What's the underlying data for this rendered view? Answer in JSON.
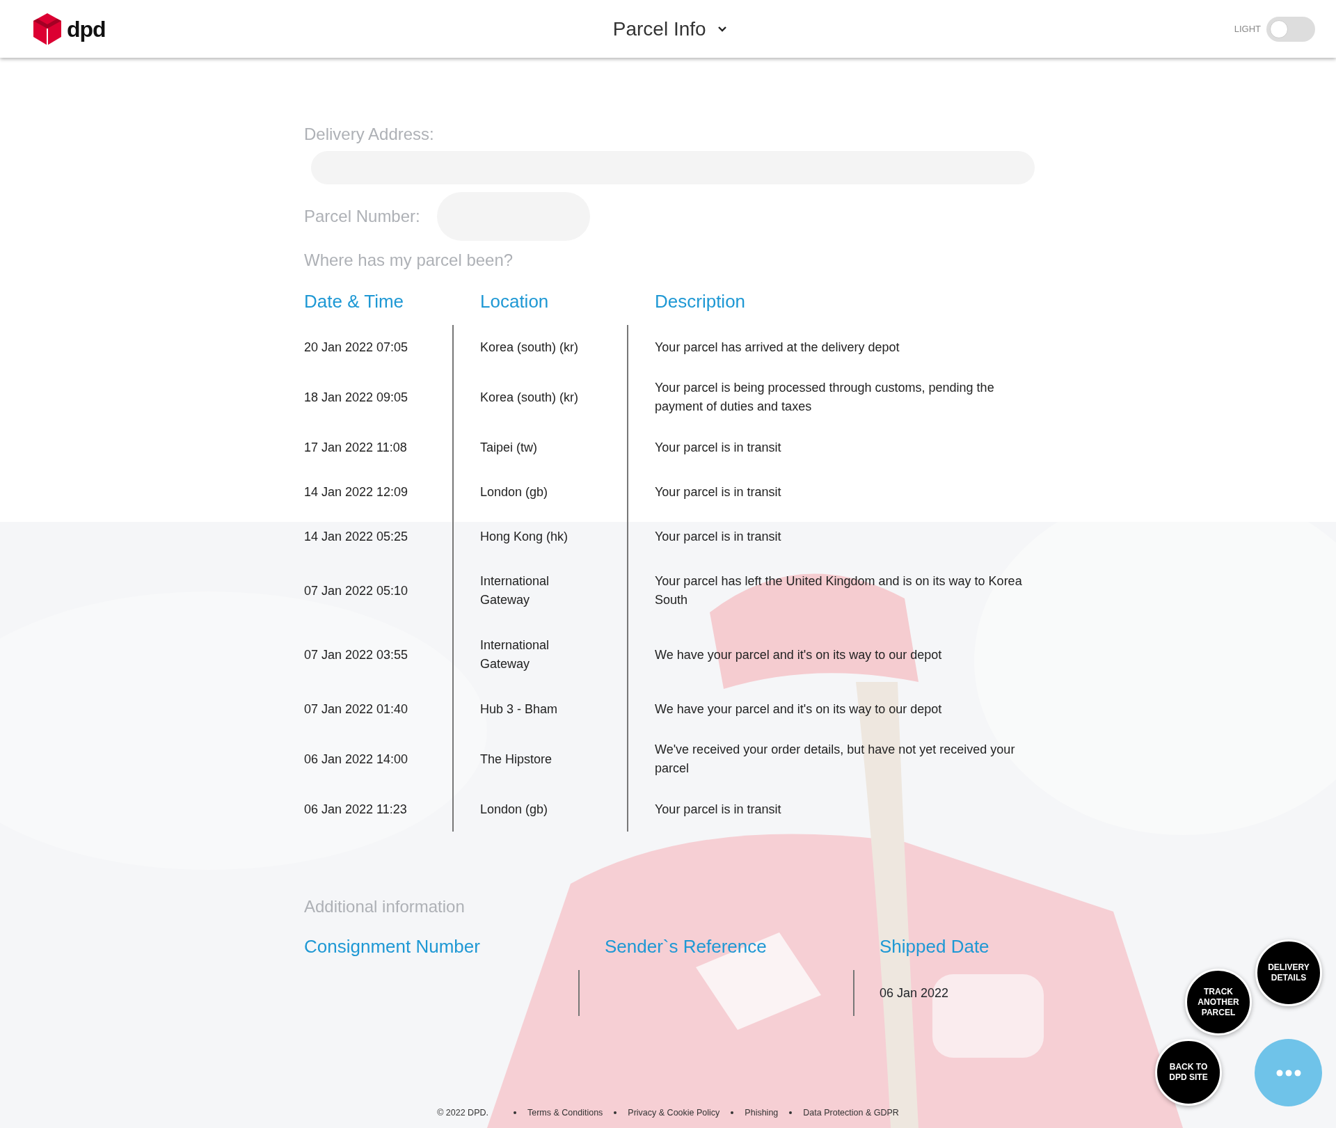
{
  "header": {
    "logo_text": "dpd",
    "title": "Parcel Info",
    "theme_toggle": {
      "label": "LIGHT",
      "on": false
    }
  },
  "details": {
    "delivery_address_label": "Delivery Address:",
    "parcel_number_label": "Parcel Number:"
  },
  "history": {
    "title": "Where has my parcel been?",
    "columns": [
      "Date & Time",
      "Location",
      "Description"
    ],
    "rows": [
      {
        "date": "20 Jan 2022 07:05",
        "location": "Korea (south) (kr)",
        "description": "Your parcel has arrived at the delivery depot"
      },
      {
        "date": "18 Jan 2022 09:05",
        "location": "Korea (south) (kr)",
        "description": "Your parcel is being processed through customs, pending the payment of duties and taxes"
      },
      {
        "date": "17 Jan 2022 11:08",
        "location": "Taipei (tw)",
        "description": "Your parcel is in transit"
      },
      {
        "date": "14 Jan 2022 12:09",
        "location": "London (gb)",
        "description": "Your parcel is in transit"
      },
      {
        "date": "14 Jan 2022 05:25",
        "location": "Hong Kong (hk)",
        "description": "Your parcel is in transit"
      },
      {
        "date": "07 Jan 2022 05:10",
        "location": "International Gateway",
        "description": "Your parcel has left the United Kingdom and is on its way to Korea South"
      },
      {
        "date": "07 Jan 2022 03:55",
        "location": "International Gateway",
        "description": "We have your parcel and it's on its way to our depot"
      },
      {
        "date": "07 Jan 2022 01:40",
        "location": "Hub 3 - Bham",
        "description": "We have your parcel and it's on its way to our depot"
      },
      {
        "date": "06 Jan 2022 14:00",
        "location": "The Hipstore",
        "description": "We've received your order details, but have not yet received your parcel"
      },
      {
        "date": "06 Jan 2022 11:23",
        "location": "London (gb)",
        "description": "Your parcel is in transit"
      }
    ]
  },
  "additional": {
    "title": "Additional information",
    "columns": [
      {
        "heading": "Consignment Number"
      },
      {
        "heading": "Sender`s Reference"
      },
      {
        "heading": "Shipped Date",
        "value": "06 Jan 2022"
      }
    ]
  },
  "footer": {
    "copyright": "© 2022 DPD.",
    "links": [
      "Terms & Conditions",
      "Privacy & Cookie Policy",
      "Phishing",
      "Data Protection & GDPR"
    ]
  },
  "action_buttons": [
    "DELIVERY DETAILS",
    "TRACK ANOTHER PARCEL",
    "BACK TO DPD SITE"
  ]
}
